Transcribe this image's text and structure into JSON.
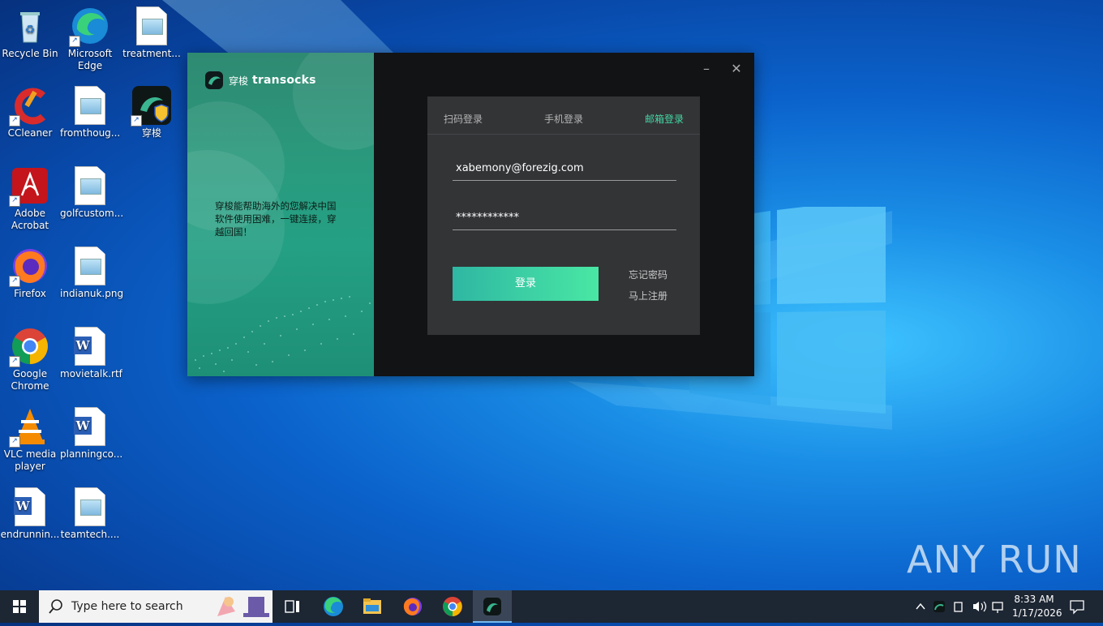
{
  "desktop": {
    "icons": [
      {
        "label": "Recycle Bin",
        "icon": "recycle-bin-icon"
      },
      {
        "label": "Microsoft Edge",
        "icon": "edge-icon"
      },
      {
        "label": "treatment...",
        "icon": "image-file-icon"
      },
      {
        "label": "CCleaner",
        "icon": "ccleaner-icon"
      },
      {
        "label": "fromthoug...",
        "icon": "image-file-icon"
      },
      {
        "label": "穿梭",
        "icon": "transocks-icon"
      },
      {
        "label": "Adobe Acrobat",
        "icon": "acrobat-icon"
      },
      {
        "label": "golfcustom...",
        "icon": "image-file-icon"
      },
      {
        "label": "Firefox",
        "icon": "firefox-icon"
      },
      {
        "label": "indianuk.png",
        "icon": "image-file-icon"
      },
      {
        "label": "Google Chrome",
        "icon": "chrome-icon"
      },
      {
        "label": "movietalk.rtf",
        "icon": "word-doc-icon"
      },
      {
        "label": "VLC media player",
        "icon": "vlc-icon"
      },
      {
        "label": "planningco...",
        "icon": "word-doc-icon"
      },
      {
        "label": "endrunnin...",
        "icon": "word-doc-icon"
      },
      {
        "label": "teamtech....",
        "icon": "image-file-icon"
      }
    ]
  },
  "app": {
    "brand_cn": "穿梭",
    "brand_en": "transocks",
    "tagline": "穿梭能帮助海外的您解决中国软件使用困难，一键连接，穿越回国！",
    "minimize": "–",
    "close": "✕",
    "tabs": [
      {
        "label": "扫码登录",
        "active": false
      },
      {
        "label": "手机登录",
        "active": false
      },
      {
        "label": "邮箱登录",
        "active": true
      }
    ],
    "email_value": "xabemony@forezig.com",
    "password_value": "************",
    "login_label": "登录",
    "forgot_label": "忘记密码",
    "register_label": "马上注册",
    "accent": "#43d7a4"
  },
  "taskbar": {
    "search_placeholder": "Type here to search",
    "time": "8:33 AM",
    "date": "1/17/2026",
    "apps": [
      "task-view-icon",
      "edge-icon",
      "file-explorer-icon",
      "firefox-icon",
      "chrome-icon",
      "transocks-icon"
    ]
  },
  "watermark": "ANY RUN"
}
